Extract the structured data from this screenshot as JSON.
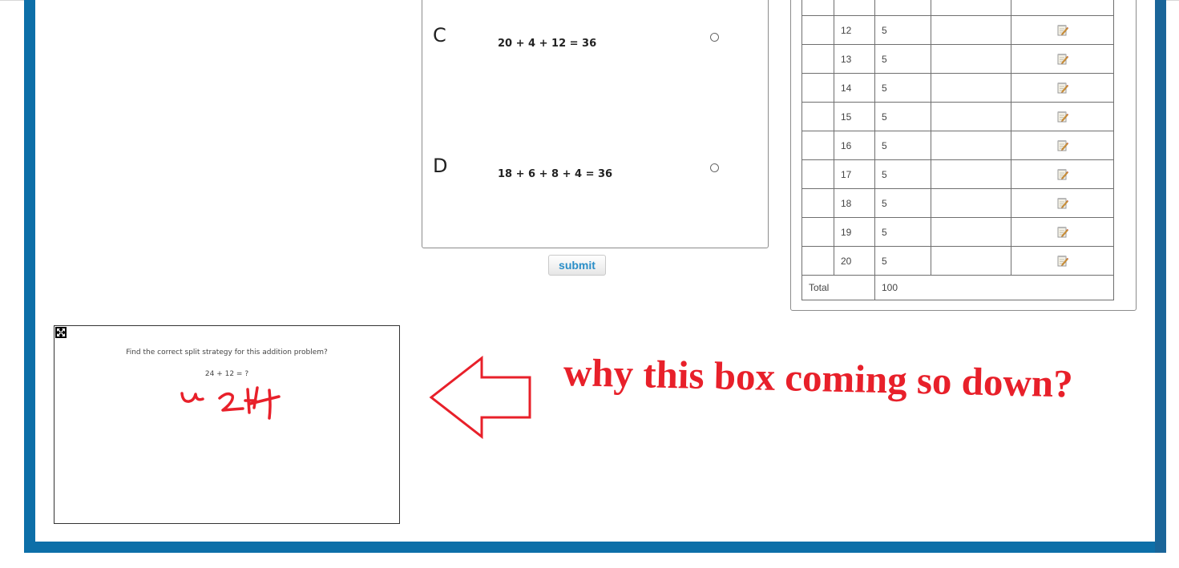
{
  "question": {
    "options": [
      {
        "letter": "C",
        "text": "20 + 4 + 12 = 36"
      },
      {
        "letter": "D",
        "text": "18 + 6 + 8 + 4 = 36"
      }
    ],
    "submit_label": "submit"
  },
  "score_table": {
    "rows": [
      {
        "number": "12",
        "points": "5"
      },
      {
        "number": "13",
        "points": "5"
      },
      {
        "number": "14",
        "points": "5"
      },
      {
        "number": "15",
        "points": "5"
      },
      {
        "number": "16",
        "points": "5"
      },
      {
        "number": "17",
        "points": "5"
      },
      {
        "number": "18",
        "points": "5"
      },
      {
        "number": "19",
        "points": "5"
      },
      {
        "number": "20",
        "points": "5"
      }
    ],
    "total_label": "Total",
    "total_value": "100",
    "row_icon": "edit-icon"
  },
  "embed": {
    "question": "Find the correct split strategy for this addition problem?",
    "equation": "24 + 12 = ?",
    "expand_icon": "expand-icon",
    "handwriting": "u 2H"
  },
  "annotation": {
    "text": "why this box  coming so down?",
    "color": "#e8202a"
  },
  "colors": {
    "frame": "#0d6fa8",
    "submit_text": "#2a8ec8"
  }
}
